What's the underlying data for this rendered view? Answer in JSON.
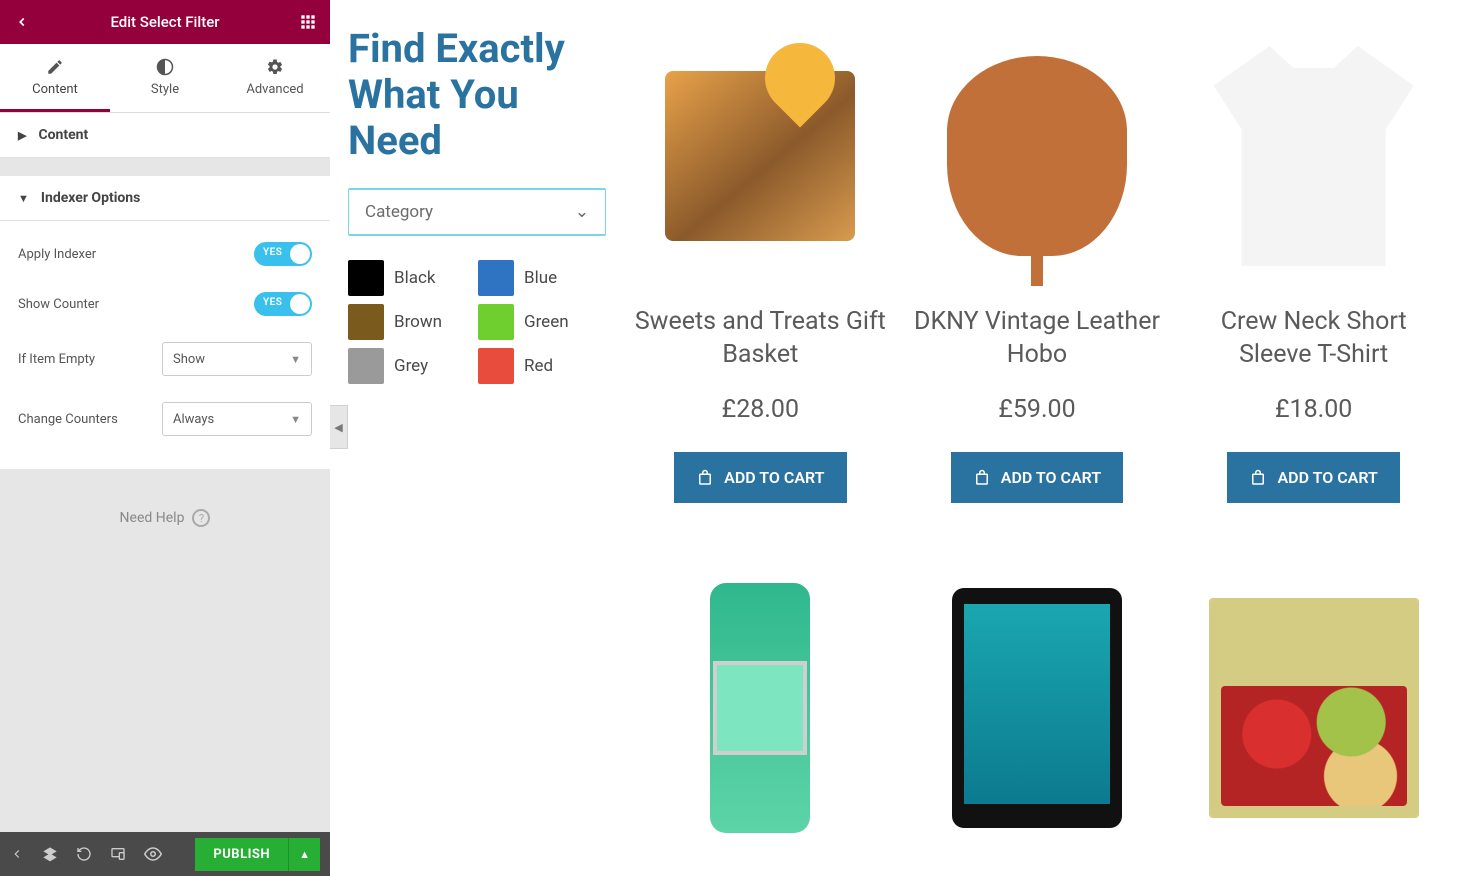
{
  "panel": {
    "title": "Edit Select Filter",
    "tabs": [
      {
        "label": "Content",
        "icon": "pencil-icon",
        "active": true
      },
      {
        "label": "Style",
        "icon": "contrast-icon",
        "active": false
      },
      {
        "label": "Advanced",
        "icon": "gear-icon",
        "active": false
      }
    ],
    "sections": {
      "content_label": "Content",
      "indexer_label": "Indexer Options"
    },
    "controls": {
      "apply_indexer_label": "Apply Indexer",
      "apply_indexer_value": "YES",
      "show_counter_label": "Show Counter",
      "show_counter_value": "YES",
      "if_empty_label": "If Item Empty",
      "if_empty_value": "Show",
      "change_counters_label": "Change Counters",
      "change_counters_value": "Always"
    },
    "help_label": "Need Help",
    "publish_label": "PUBLISH"
  },
  "preview": {
    "title": "Find Exactly What You Need",
    "category_placeholder": "Category",
    "colors": [
      {
        "label": "Black",
        "hex": "#000000"
      },
      {
        "label": "Blue",
        "hex": "#2f74c2"
      },
      {
        "label": "Brown",
        "hex": "#7b5a1d"
      },
      {
        "label": "Green",
        "hex": "#6fcf2f"
      },
      {
        "label": "Grey",
        "hex": "#9a9a9a"
      },
      {
        "label": "Red",
        "hex": "#e74c3c"
      }
    ],
    "add_to_cart_label": "ADD TO CART",
    "products": [
      {
        "name": "Sweets and Treats Gift Basket",
        "price": "£28.00",
        "img": "basket"
      },
      {
        "name": "DKNY Vintage Leather Hobo",
        "price": "£59.00",
        "img": "hobo"
      },
      {
        "name": "Crew Neck Short Sleeve T-Shirt",
        "price": "£18.00",
        "img": "tshirt"
      },
      {
        "name": "",
        "price": "",
        "img": "watch"
      },
      {
        "name": "",
        "price": "",
        "img": "tablet"
      },
      {
        "name": "",
        "price": "",
        "img": "fruit"
      }
    ]
  }
}
